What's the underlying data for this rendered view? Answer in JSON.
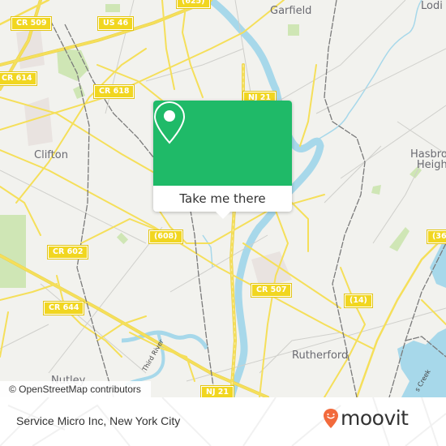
{
  "map": {
    "colors": {
      "background": "#f2f2ee",
      "road": "#f5df5a",
      "water": "#a7d8ea",
      "park": "#cfe6b5",
      "rail": "#777777",
      "accent": "#1fba68",
      "shield": "#f1d620"
    },
    "road_shields": [
      {
        "id": "cr509",
        "label": "CR 509"
      },
      {
        "id": "us46",
        "label": "US 46"
      },
      {
        "id": "r625",
        "label": "(625)"
      },
      {
        "id": "cr614",
        "label": "CR 614"
      },
      {
        "id": "cr618",
        "label": "CR 618"
      },
      {
        "id": "nj21a",
        "label": "NJ 21"
      },
      {
        "id": "r608",
        "label": "(608)"
      },
      {
        "id": "cr602",
        "label": "CR 602"
      },
      {
        "id": "cr644",
        "label": "CR 644"
      },
      {
        "id": "cr507",
        "label": "CR 507"
      },
      {
        "id": "r14",
        "label": "(14)"
      },
      {
        "id": "r36",
        "label": "(36"
      },
      {
        "id": "nj21b",
        "label": "NJ 21"
      }
    ],
    "places": [
      {
        "id": "garfield",
        "label": "Garfield"
      },
      {
        "id": "lodi",
        "label": "Lodi"
      },
      {
        "id": "clifton",
        "label": "Clifton"
      },
      {
        "id": "hasbrouck",
        "label": "Hasbro\nHeigh"
      },
      {
        "id": "rutherford",
        "label": "Rutherford"
      },
      {
        "id": "nutley",
        "label": "Nutley"
      }
    ],
    "street_labels": [
      {
        "id": "third-river",
        "label": "Third River"
      },
      {
        "id": "creek",
        "label": "s Creek"
      }
    ],
    "attribution": "© OpenStreetMap contributors"
  },
  "popup": {
    "icon": "map-pin-icon",
    "cta_label": "Take me there"
  },
  "footer": {
    "title": "Service Micro Inc, New York City",
    "logo_text": "moovit",
    "logo_icon": "moovit-smiley-pin-icon",
    "logo_color": "#f26a3c"
  }
}
